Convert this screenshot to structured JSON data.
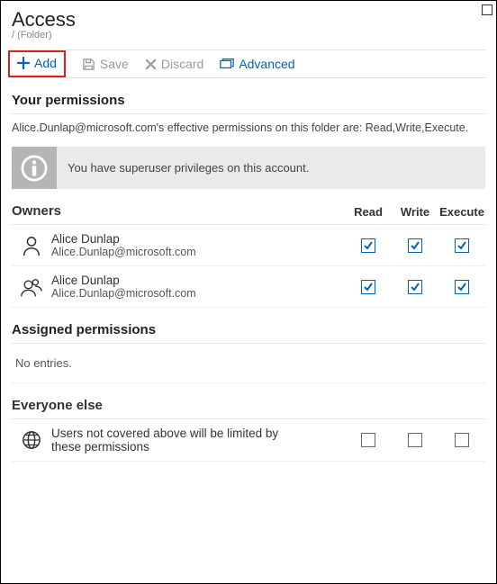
{
  "header": {
    "title": "Access",
    "subtitle": "/ (Folder)"
  },
  "toolbar": {
    "add_label": "Add",
    "save_label": "Save",
    "discard_label": "Discard",
    "advanced_label": "Advanced"
  },
  "your_permissions": {
    "heading": "Your permissions",
    "description": "Alice.Dunlap@microsoft.com's effective permissions on this folder are: Read,Write,Execute.",
    "info": "You have superuser privileges on this account."
  },
  "owners": {
    "heading": "Owners",
    "columns": {
      "read": "Read",
      "write": "Write",
      "execute": "Execute"
    },
    "rows": [
      {
        "name": "Alice Dunlap",
        "email": "Alice.Dunlap@microsoft.com",
        "read": true,
        "write": true,
        "execute": true
      },
      {
        "name": "Alice Dunlap",
        "email": "Alice.Dunlap@microsoft.com",
        "read": true,
        "write": true,
        "execute": true
      }
    ]
  },
  "assigned": {
    "heading": "Assigned permissions",
    "empty": "No entries."
  },
  "everyone": {
    "heading": "Everyone else",
    "description": "Users not covered above will be limited by these permissions",
    "read": false,
    "write": false,
    "execute": false
  }
}
